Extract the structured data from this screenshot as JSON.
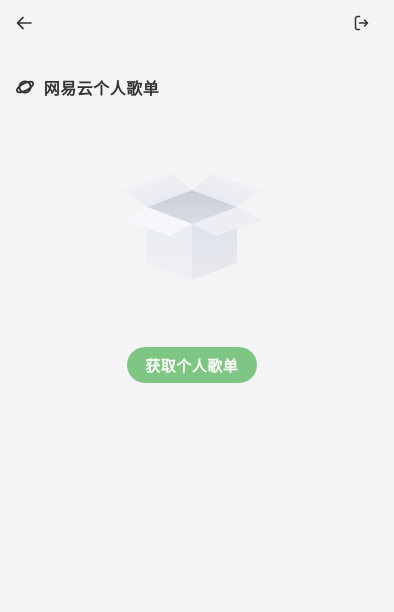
{
  "topbar": {
    "back_icon": "arrow-left-icon",
    "logout_icon": "logout-icon"
  },
  "section": {
    "icon": "planet-icon",
    "title": "网易云个人歌单"
  },
  "empty_state": {
    "illustration": "empty-box-icon"
  },
  "fetch_button": {
    "label": "获取个人歌单",
    "color": "#7fc684"
  },
  "colors": {
    "background": "#f4f4f6",
    "text": "#333333",
    "accent": "#7fc684"
  }
}
